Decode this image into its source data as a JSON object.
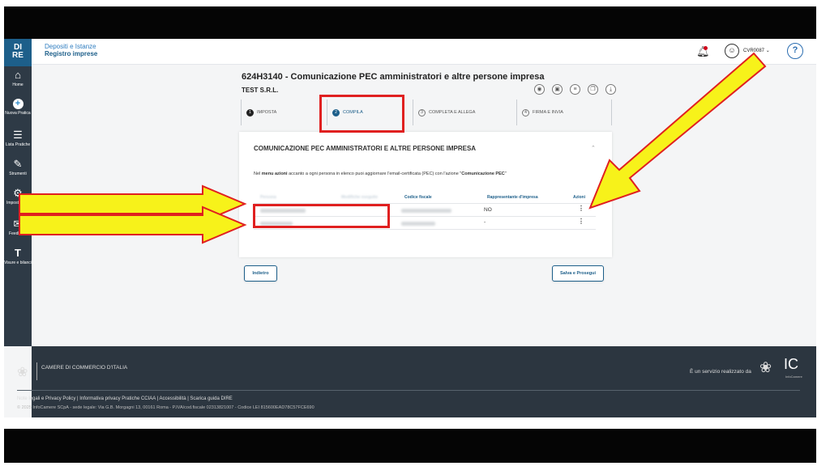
{
  "header": {
    "app_sub": "Depositi e Istanze",
    "app_title": "Registro imprese",
    "user_name": "CVR0087",
    "help_label": "?"
  },
  "sidebar": {
    "logo_top": "DI",
    "logo_bottom": "RE",
    "items": [
      {
        "label": "Home",
        "icon": "home-icon"
      },
      {
        "label": "Nuova Pratica",
        "icon": "plus-circle-icon"
      },
      {
        "label": "Lista Pratiche",
        "icon": "document-list-icon"
      },
      {
        "label": "Strumenti",
        "icon": "wrench-icon"
      },
      {
        "label": "Impostazioni",
        "icon": "gear-icon"
      },
      {
        "label": "Feedback",
        "icon": "feedback-icon"
      },
      {
        "label": "Visure e bilanci",
        "icon": "text-t-icon"
      }
    ]
  },
  "page": {
    "title": "624H3140 - Comunicazione PEC amministratori e altre persone impresa",
    "company": "TEST S.R.L.",
    "toolbar_icons": [
      "view-icon",
      "save-icon",
      "document-icon",
      "copy-icon",
      "download-icon"
    ]
  },
  "steps": [
    {
      "num": "1",
      "label": "IMPOSTA",
      "state": "done"
    },
    {
      "num": "2",
      "label": "COMPILA",
      "state": "active"
    },
    {
      "num": "3",
      "label": "COMPLETA E ALLEGA",
      "state": "todo"
    },
    {
      "num": "4",
      "label": "FIRMA E INVIA",
      "state": "todo"
    }
  ],
  "card": {
    "title": "COMUNICAZIONE PEC AMMINISTRATORI E ALTRE PERSONE IMPRESA",
    "desc_pre": "Nel ",
    "desc_bold1": "menu azioni",
    "desc_mid": " accanto a ogni persona in elenco puoi aggiornare l'email-certificata (PEC) con l'azione \"",
    "desc_bold2": "Comunicazione PEC",
    "desc_post": "\"",
    "columns": [
      "Persona",
      "Modifiche eseguite",
      "Codice fiscale",
      "Rappresentante d'impresa",
      "Azioni"
    ],
    "rows": [
      {
        "rappresentante": "NO"
      },
      {
        "rappresentante": "-"
      }
    ]
  },
  "buttons": {
    "back": "Indietro",
    "save": "Salva e Prosegui"
  },
  "footer": {
    "org_name": "CAMERE DI COMMERCIO D'ITALIA",
    "service_text": "È un servizio realizzato da",
    "ic_logo": "IC",
    "ic_sub": "InfoCamere",
    "links": "Note legali e Privacy Policy  |  Informativa privacy Pratiche CCIAA  |  Accessibilità  |  Scarica guida DIRE",
    "copyright": "© 2025 InfoCamere SCpA - sede legale: Via G.B. Morgagni 13, 00161 Roma - P.IVA/cod.fiscale 02313821007 - Codice LEI 815600EAD78C57FCE690"
  },
  "annotation": {
    "arrow_color": "#f7f21a",
    "box_color": "#e02020"
  }
}
